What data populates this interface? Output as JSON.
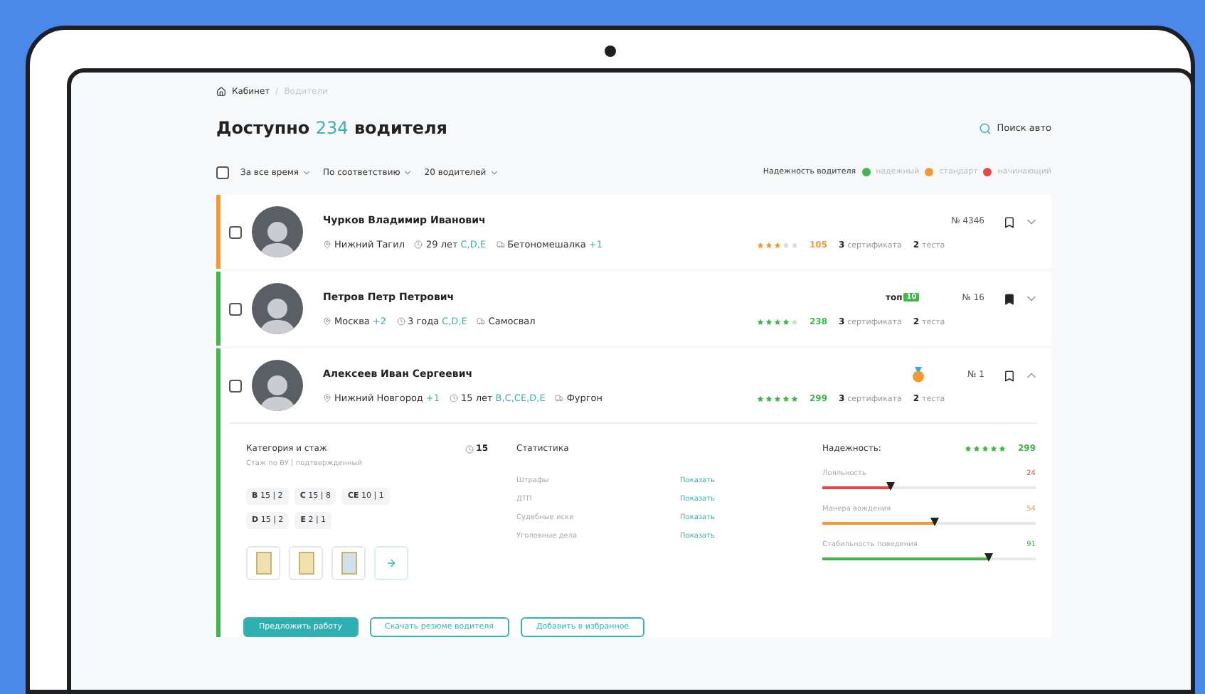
{
  "breadcrumb": {
    "items": [
      "Кабинет",
      "Водители"
    ],
    "separator": "/"
  },
  "heading": {
    "prefix": "Доступно",
    "count": "234",
    "suffix": "водителя"
  },
  "search_link": "Поиск авто",
  "toolbar": {
    "select_all": {
      "checked": false
    },
    "filters": [
      "За все время",
      "По соответствию",
      "20 водителей"
    ],
    "legend": {
      "title": "Надежность водителя",
      "items": [
        {
          "label": "надежный",
          "color": "#43b649"
        },
        {
          "label": "стандарт",
          "color": "#f29a38"
        },
        {
          "label": "начинающий",
          "color": "#e8453c"
        }
      ]
    }
  },
  "drivers": [
    {
      "name": "Чурков Владимир Иванович",
      "city": "Нижний Тагил",
      "experience": "29 лет",
      "categories": "C,D,E",
      "vehicle": "Бетономешалка",
      "vehicle_extra": "+1",
      "badge": {
        "kind": "none"
      },
      "number": "№ 4346",
      "stars": 3,
      "rating": "105",
      "certificates": "3",
      "certificates_label": "сертификата",
      "tests": "2",
      "tests_label": "теста",
      "color": "#f29a38",
      "checked": false,
      "bookmarked": false,
      "expanded": false
    },
    {
      "name": "Петров Петр Петрович",
      "city": "Москва",
      "city_extra": "+2",
      "experience": "3 года",
      "categories": "C,D,E",
      "vehicle": "Самосвал",
      "badge": {
        "kind": "tag",
        "text": "топ",
        "value": "10"
      },
      "number": "№ 16",
      "stars": 4,
      "rating": "238",
      "certificates": "3",
      "certificates_label": "сертификата",
      "tests": "2",
      "tests_label": "теста",
      "color": "#43b649",
      "checked": false,
      "bookmarked": true,
      "expanded": false
    },
    {
      "name": "Алексеев Иван Сергеевич",
      "city": "Нижний Новгород",
      "city_extra": "+1",
      "experience": "15 лет",
      "categories": "B,C,CE,D,E",
      "vehicle": "Фургон",
      "badge": {
        "kind": "medal"
      },
      "number": "№ 1",
      "stars": 5,
      "rating": "299",
      "certificates": "3",
      "certificates_label": "сертификата",
      "tests": "2",
      "tests_label": "теста",
      "color": "#43b649",
      "checked": false,
      "bookmarked": false,
      "expanded": true
    }
  ],
  "details": {
    "categories_title": "Категория и стаж",
    "years": "15",
    "subtitle": "Стаж по ВУ | подтвержденный",
    "licenses": [
      {
        "cat": "B",
        "value": "15 | 2"
      },
      {
        "cat": "C",
        "value": "15 | 8"
      },
      {
        "cat": "CE",
        "value": "10 | 1"
      },
      {
        "cat": "D",
        "value": "15 | 2"
      },
      {
        "cat": "E",
        "value": "2 | 1"
      }
    ],
    "documents": [
      {
        "color": "#efe2b0"
      },
      {
        "color": "#efe2b0"
      },
      {
        "color": "#cfe0f0"
      }
    ],
    "stats_title": "Статистика",
    "stats": [
      {
        "label": "Штрафы",
        "link": "Показать"
      },
      {
        "label": "ДТП",
        "link": "Показать"
      },
      {
        "label": "Судебные иски",
        "link": "Показать"
      },
      {
        "label": "Уголовные дела",
        "link": "Показать"
      }
    ],
    "reliability_title": "Надежность:",
    "stars": 5,
    "rating": "299",
    "metrics": [
      {
        "label": "Лояльность",
        "value": "24",
        "level": 0.32,
        "color": "#e8453c"
      },
      {
        "label": "Манера вождения",
        "value": "54",
        "level": 0.53,
        "color": "#f29a38"
      },
      {
        "label": "Стабильность поведения",
        "value": "91",
        "level": 0.78,
        "color": "#43b649"
      }
    ],
    "actions": [
      {
        "label": "Предложить работу",
        "kind": "primary"
      },
      {
        "label": "Скачать резюме водителя",
        "kind": "outline"
      },
      {
        "label": "Добавить в избранное",
        "kind": "outline"
      }
    ]
  }
}
